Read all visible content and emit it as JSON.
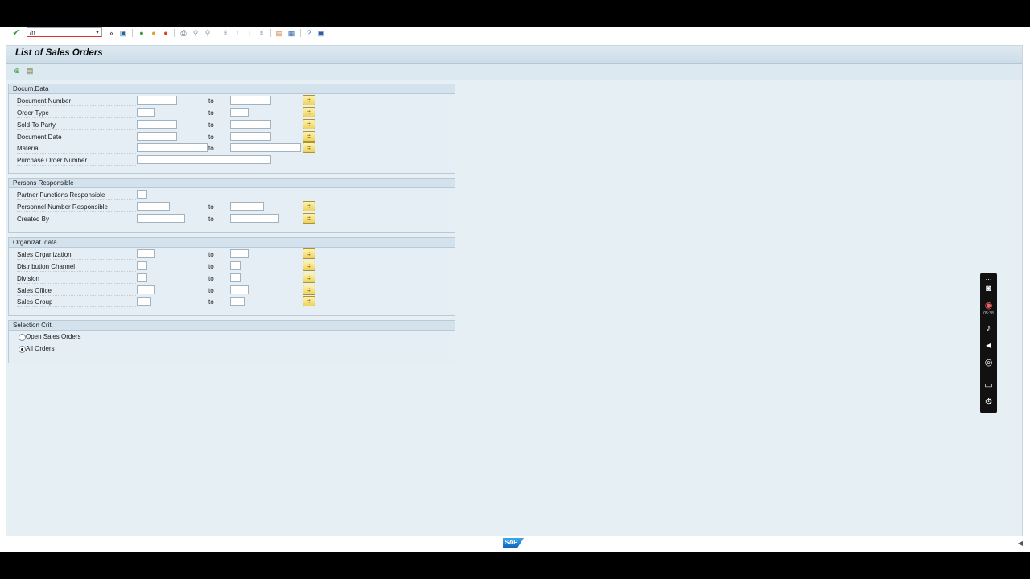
{
  "toolbar": {
    "command_value": "/n",
    "icons": [
      "enter-icon",
      "command-field",
      "back-arrows-icon",
      "save-icon",
      "back-icon",
      "exit-icon",
      "cancel-icon",
      "print-icon",
      "find-icon",
      "find-next-icon",
      "first-page-icon",
      "previous-page-icon",
      "next-page-icon",
      "last-page-icon",
      "new-session-icon",
      "shortcut-icon",
      "help-icon",
      "customize-layout-icon"
    ]
  },
  "page": {
    "title": "List of Sales Orders"
  },
  "sections": {
    "docum": {
      "title": "Docum.Data",
      "rows": [
        {
          "label": "Document Number",
          "to": "to"
        },
        {
          "label": "Order Type",
          "to": "to"
        },
        {
          "label": "Sold-To Party",
          "to": "to"
        },
        {
          "label": "Document Date",
          "to": "to"
        },
        {
          "label": "Material",
          "to": "to"
        },
        {
          "label": "Purchase Order Number"
        }
      ]
    },
    "persons": {
      "title": "Persons Responsible",
      "rows": [
        {
          "label": "Partner Functions Responsible"
        },
        {
          "label": "Personnel Number Responsible",
          "to": "to"
        },
        {
          "label": "Created By",
          "to": "to"
        }
      ]
    },
    "org": {
      "title": "Organizat. data",
      "rows": [
        {
          "label": "Sales Organization",
          "to": "to"
        },
        {
          "label": "Distribution Channel",
          "to": "to"
        },
        {
          "label": "Division",
          "to": "to"
        },
        {
          "label": "Sales Office",
          "to": "to"
        },
        {
          "label": "Sales Group",
          "to": "to"
        }
      ]
    },
    "selection": {
      "title": "Selection Crit.",
      "options": [
        {
          "label": "Open Sales Orders",
          "selected": false
        },
        {
          "label": "All Orders",
          "selected": true
        }
      ]
    }
  },
  "footer": {
    "logo": "SAP"
  },
  "recorder": {
    "time": "05:38"
  },
  "colors": {
    "accent": "#1166b8",
    "background": "#e6eff4",
    "multi_select_button": "#eed25c"
  }
}
